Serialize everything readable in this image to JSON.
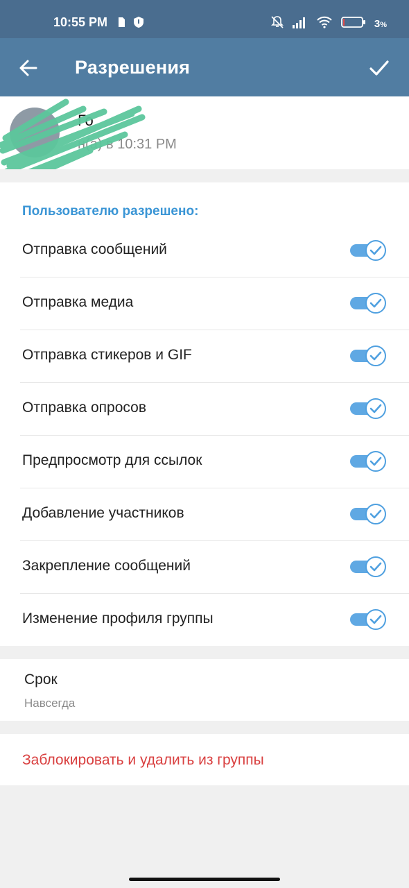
{
  "status_bar": {
    "time": "10:55 PM",
    "battery_percent": "3",
    "battery_percent_suffix": "%",
    "icons": [
      "sim-card-icon",
      "shield-icon",
      "bell-off-icon",
      "signal-icon",
      "wifi-icon",
      "battery-icon"
    ]
  },
  "app_bar": {
    "title": "Разрешения",
    "back_icon": "arrow-left-icon",
    "done_icon": "checkmark-icon"
  },
  "user": {
    "name": "Го",
    "status": "н(а) в 10:31 PM"
  },
  "permissions": {
    "header": "Пользователю разрешено:",
    "items": [
      {
        "label": "Отправка сообщений",
        "enabled": true
      },
      {
        "label": "Отправка медиа",
        "enabled": true
      },
      {
        "label": "Отправка стикеров и GIF",
        "enabled": true
      },
      {
        "label": "Отправка опросов",
        "enabled": true
      },
      {
        "label": "Предпросмотр для ссылок",
        "enabled": true
      },
      {
        "label": "Добавление участников",
        "enabled": true
      },
      {
        "label": "Закрепление сообщений",
        "enabled": true
      },
      {
        "label": "Изменение профиля группы",
        "enabled": true
      }
    ]
  },
  "term": {
    "title": "Срок",
    "value": "Навсегда"
  },
  "ban": {
    "label": "Заблокировать и удалить из группы"
  },
  "colors": {
    "status_bar": "#4a6d8f",
    "app_bar": "#517da2",
    "accent": "#3a95d5",
    "toggle_on": "#5fa8e3",
    "danger": "#d94040",
    "background": "#f0f0f0"
  }
}
